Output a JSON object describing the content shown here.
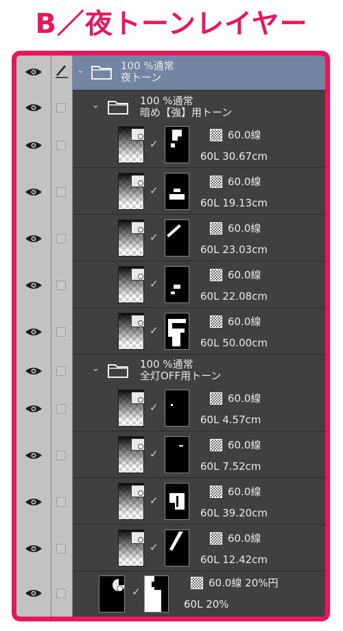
{
  "heading": "B／夜トーンレイヤー",
  "colors": {
    "accent": "#e8175d",
    "panel_bg": "#404040",
    "selected_row": "#7286a3",
    "column_bg": "#c2c2c2"
  },
  "root_folder": {
    "opacity_blend": "100 %通常",
    "name": "夜トーン"
  },
  "folder_1": {
    "opacity_blend": "100 %通常",
    "name": "暗め【強】用トーン"
  },
  "folder_1_layers": [
    {
      "tone": "60.0線",
      "info": "60L 30.67cm"
    },
    {
      "tone": "60.0線",
      "info": "60L 19.13cm"
    },
    {
      "tone": "60.0線",
      "info": "60L 23.03cm"
    },
    {
      "tone": "60.0線",
      "info": "60L 22.08cm"
    },
    {
      "tone": "60.0線",
      "info": "60L 50.00cm"
    }
  ],
  "folder_2": {
    "opacity_blend": "100 %通常",
    "name": "全灯OFF用トーン"
  },
  "folder_2_layers": [
    {
      "tone": "60.0線",
      "info": "60L 4.57cm"
    },
    {
      "tone": "60.0線",
      "info": "60L 7.52cm"
    },
    {
      "tone": "60.0線",
      "info": "60L 39.20cm"
    },
    {
      "tone": "60.0線",
      "info": "60L 12.42cm"
    }
  ],
  "bottom_layer": {
    "tone": "60.0線 20%円",
    "info": "60L 20%"
  },
  "icons": {
    "eye": "eye-icon",
    "pencil": "pencil-icon",
    "folder": "folder-icon",
    "chevron": "chevron-down-icon",
    "tone": "tone-pattern-icon",
    "check": "checkmark-icon"
  }
}
